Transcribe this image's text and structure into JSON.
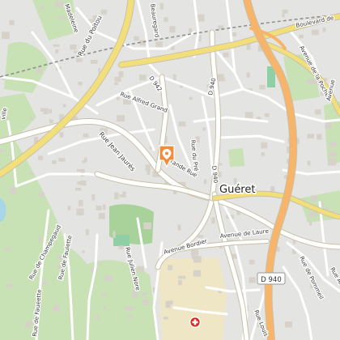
{
  "map": {
    "city_label": "Guéret",
    "colors": {
      "background": "#e4e4e2",
      "green_area": "#c9e2b5",
      "green_dark": "#a9d19a",
      "pitch": "#8ecfa4",
      "water": "#a8d5e8",
      "major_road": "#f3df7a",
      "highway": "#f6b56a",
      "marker": "#ef8d3a",
      "hospital": "#d6261f",
      "hospital_zone": "#efe6c6"
    },
    "streets": {
      "rue_du_poitou": "Rue du Poitou",
      "madeleine": "Madeleine",
      "beauregard": "Beauregard",
      "boulevard_de": "Boulevard de",
      "avenue_de_la_poche": "Avenue de la Poche",
      "d942": "D 942",
      "d940_top": "D 940",
      "rue_alfred_grand": "Rue Alfred Grand",
      "rue_jean_jaures": "Rue Jean Jaurès",
      "rue_du_pre": "Rue du Pré",
      "grande_rue": "Grande Rue",
      "d940_mid": "D 940",
      "avenue_de_laure": "Avenue de Laure",
      "avenue_bordier": "Avenue Bordier",
      "d940_badge": "D 940",
      "rue_julien_nore": "Rue Julien Nore",
      "rue_de_champegaud": "Rue de Champegaud",
      "rue_de_fauiette": "Rue de Fauiette",
      "rue_de_faueette": "Rue de Faueette",
      "rue_de_pommeil": "Rue de Pommeil",
      "rue_louis": "Rue Louis",
      "rue_ar": "Rue Ar",
      "ville": "ville",
      "avenue_right": "Avenue"
    },
    "icons": {
      "marker": "location-pin-icon",
      "hospital": "hospital-cross-icon"
    }
  }
}
